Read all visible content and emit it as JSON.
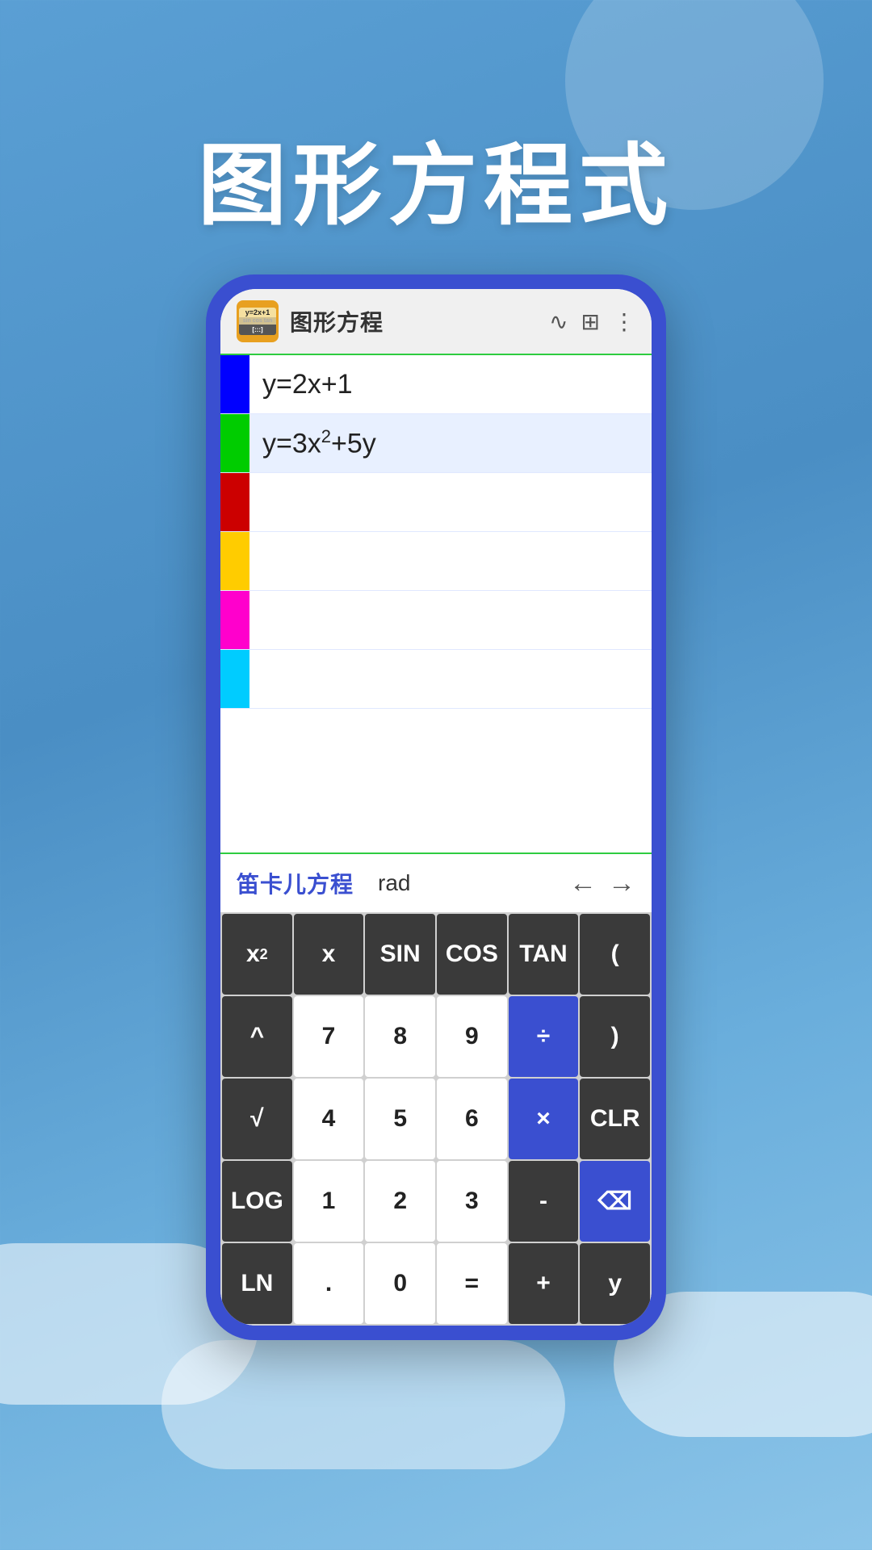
{
  "page": {
    "title": "图形方程式",
    "background_color": "#5a9fd4"
  },
  "app": {
    "icon_line1": "y=2x+1",
    "icon_line2": "sin cos tan",
    "icon_line3": "[:::]",
    "header_title": "图形方程",
    "header_icon_wave": "∿",
    "header_icon_grid": "⊞",
    "header_icon_more": "⋮"
  },
  "equations": [
    {
      "color": "#0000ff",
      "text": "y=2x+1",
      "has_superscript": false,
      "active": false
    },
    {
      "color": "#00cc00",
      "text_before": "y=3x",
      "superscript": "2",
      "text_after": "+5y",
      "has_superscript": true,
      "active": true
    },
    {
      "color": "#cc0000",
      "text": "",
      "has_superscript": false,
      "active": false
    },
    {
      "color": "#ffcc00",
      "text": "",
      "has_superscript": false,
      "active": false
    },
    {
      "color": "#ff00cc",
      "text": "",
      "has_superscript": false,
      "active": false
    },
    {
      "color": "#00ccff",
      "text": "",
      "has_superscript": false,
      "active": false
    }
  ],
  "mode_bar": {
    "mode_label": "笛卡儿方程",
    "rad_label": "rad",
    "left_arrow": "←",
    "right_arrow": "→"
  },
  "keyboard": {
    "rows": [
      [
        {
          "label": "x²",
          "type": "dark",
          "has_sup": true,
          "base": "x",
          "sup": "2"
        },
        {
          "label": "x",
          "type": "dark"
        },
        {
          "label": "SIN",
          "type": "dark"
        },
        {
          "label": "COS",
          "type": "dark"
        },
        {
          "label": "TAN",
          "type": "dark"
        },
        {
          "label": "(",
          "type": "dark"
        }
      ],
      [
        {
          "label": "^",
          "type": "dark"
        },
        {
          "label": "7",
          "type": "light"
        },
        {
          "label": "8",
          "type": "light"
        },
        {
          "label": "9",
          "type": "light"
        },
        {
          "label": "÷",
          "type": "blue"
        },
        {
          "label": ")",
          "type": "dark"
        }
      ],
      [
        {
          "label": "√",
          "type": "dark"
        },
        {
          "label": "4",
          "type": "light"
        },
        {
          "label": "5",
          "type": "light"
        },
        {
          "label": "6",
          "type": "light"
        },
        {
          "label": "×",
          "type": "blue"
        },
        {
          "label": "CLR",
          "type": "dark"
        }
      ],
      [
        {
          "label": "LOG",
          "type": "dark"
        },
        {
          "label": "1",
          "type": "light"
        },
        {
          "label": "2",
          "type": "light"
        },
        {
          "label": "3",
          "type": "light"
        },
        {
          "label": "-",
          "type": "dark"
        },
        {
          "label": "⌫",
          "type": "blue"
        }
      ],
      [
        {
          "label": "LN",
          "type": "dark"
        },
        {
          "label": ".",
          "type": "light"
        },
        {
          "label": "0",
          "type": "light"
        },
        {
          "label": "=",
          "type": "light"
        },
        {
          "label": "+",
          "type": "dark"
        },
        {
          "label": "y",
          "type": "dark"
        }
      ]
    ]
  }
}
